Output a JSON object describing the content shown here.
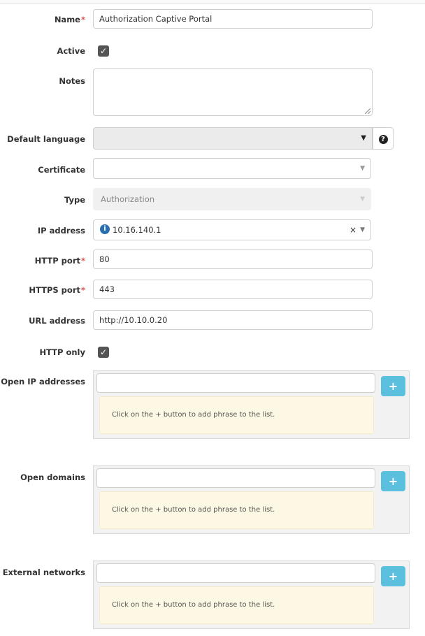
{
  "form": {
    "name": {
      "label": "Name",
      "required_mark": "*",
      "value": "Authorization Captive Portal"
    },
    "active": {
      "label": "Active",
      "checked": true
    },
    "notes": {
      "label": "Notes",
      "value": ""
    },
    "default_language": {
      "label": "Default language",
      "value": ""
    },
    "certificate": {
      "label": "Certificate",
      "value": ""
    },
    "type": {
      "label": "Type",
      "value": "Authorization"
    },
    "ip_address": {
      "label": "IP address",
      "value": "10.16.140.1",
      "clear": "×"
    },
    "http_port": {
      "label": "HTTP port",
      "required_mark": "*",
      "value": "80"
    },
    "https_port": {
      "label": "HTTPS port",
      "required_mark": "*",
      "value": "443"
    },
    "url_address": {
      "label": "URL address",
      "value": "http://10.10.0.20"
    },
    "http_only": {
      "label": "HTTP only",
      "checked": true
    },
    "open_ip_addresses": {
      "label": "Open IP addresses",
      "hint": "Click on the + button to add phrase to the list."
    },
    "open_domains": {
      "label": "Open domains",
      "hint": "Click on the + button to add phrase to the list."
    },
    "external_networks": {
      "label": "External networks",
      "hint": "Click on the + button to add phrase to the list."
    }
  },
  "glyphs": {
    "check": "✓",
    "caret": "▼",
    "help": "?",
    "info": "i",
    "plus": "+"
  },
  "colors": {
    "required": "#d9534f",
    "add_button": "#5bc0de",
    "hint_bg": "#fcf8e3",
    "info_icon": "#2a6fb0"
  }
}
